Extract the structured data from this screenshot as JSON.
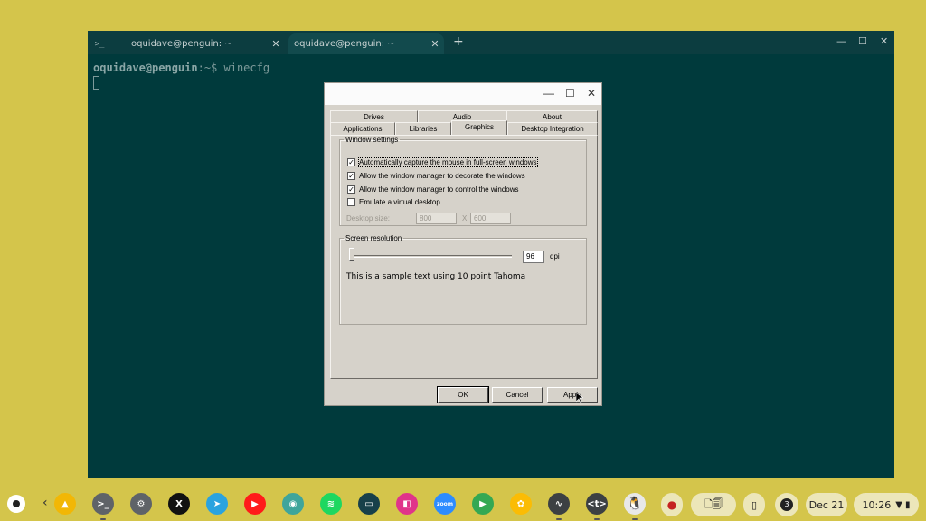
{
  "terminal": {
    "tabs": [
      {
        "icon": ">_",
        "title": "oquidave@penguin: ~",
        "close": "✕"
      },
      {
        "title": "oquidave@penguin: ~",
        "close": "✕"
      }
    ],
    "new_tab": "+",
    "window_controls": {
      "minimize": "—",
      "maximize": "☐",
      "close": "✕"
    },
    "prompt_user": "oquidave@penguin",
    "prompt_path": ":~$ ",
    "command": "winecfg"
  },
  "dialog": {
    "title_controls": {
      "minimize": "—",
      "maximize": "☐",
      "close": "✕"
    },
    "tabs_row1": [
      "Drives",
      "Audio",
      "About"
    ],
    "tabs_row2": [
      "Applications",
      "Libraries",
      "Graphics",
      "Desktop Integration"
    ],
    "active_tab": "Graphics",
    "window_settings": {
      "legend": "Window settings",
      "options": [
        {
          "label": "Automatically capture the mouse in full-screen windows",
          "checked": true
        },
        {
          "label": "Allow the window manager to decorate the windows",
          "checked": true
        },
        {
          "label": "Allow the window manager to control the windows",
          "checked": true
        },
        {
          "label": "Emulate a virtual desktop",
          "checked": false
        }
      ],
      "desktop_size_label": "Desktop size:",
      "width": "800",
      "separator": "X",
      "height": "600"
    },
    "screen_resolution": {
      "legend": "Screen resolution",
      "dpi_value": "96",
      "dpi_unit": "dpi",
      "sample_text": "This is a sample text using 10 point Tahoma"
    },
    "buttons": {
      "ok": "OK",
      "cancel": "Cancel",
      "apply": "Apply"
    }
  },
  "shelf": {
    "apps": [
      {
        "name": "drive",
        "glyph": "▲",
        "color": "#f2b705"
      },
      {
        "name": "terminal",
        "glyph": ">_",
        "color": "#5f6368"
      },
      {
        "name": "settings",
        "glyph": "⚙",
        "color": "#5f6368"
      },
      {
        "name": "x",
        "glyph": "X",
        "color": "#111111"
      },
      {
        "name": "telegram",
        "glyph": "➤",
        "color": "#2aa3df"
      },
      {
        "name": "youtube",
        "glyph": "▶",
        "color": "#ff1a1a"
      },
      {
        "name": "app",
        "glyph": "◉",
        "color": "#3fa59b"
      },
      {
        "name": "spotify",
        "glyph": "≋",
        "color": "#1ed760"
      },
      {
        "name": "screencast",
        "glyph": "▭",
        "color": "#17404a"
      },
      {
        "name": "app",
        "glyph": "◧",
        "color": "#e0348a"
      },
      {
        "name": "zoom",
        "glyph": "zoom",
        "color": "#2d8cff"
      },
      {
        "name": "play-store",
        "glyph": "▶",
        "color": "#34a853"
      },
      {
        "name": "photos",
        "glyph": "✿",
        "color": "#fbbc04"
      },
      {
        "name": "activity",
        "glyph": "∿",
        "color": "#3c4043"
      },
      {
        "name": "code",
        "glyph": "<t>",
        "color": "#3c4043"
      },
      {
        "name": "penguin",
        "glyph": "🐧",
        "color": "#e8e8e8"
      }
    ],
    "tray": {
      "record": "●",
      "notifications": "3",
      "date": "Dec 21",
      "time": "10:26"
    }
  }
}
